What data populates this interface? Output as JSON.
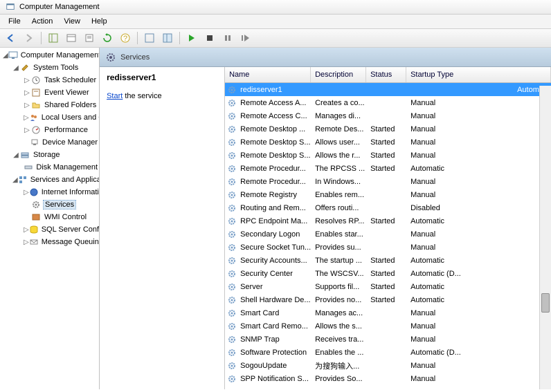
{
  "title": "Computer Management",
  "menu": [
    "File",
    "Action",
    "View",
    "Help"
  ],
  "tree": {
    "root": "Computer Management (Local",
    "systools": "System Tools",
    "systools_items": [
      "Task Scheduler",
      "Event Viewer",
      "Shared Folders",
      "Local Users and Groups",
      "Performance",
      "Device Manager"
    ],
    "storage": "Storage",
    "storage_items": [
      "Disk Management"
    ],
    "sapps": "Services and Applications",
    "sapps_items": [
      "Internet Information Se",
      "Services",
      "WMI Control",
      "SQL Server Configuratio",
      "Message Queuing"
    ]
  },
  "header_label": "Services",
  "detail": {
    "title": "redisserver1",
    "link": "Start",
    "link_rest": " the service"
  },
  "columns": {
    "name": "Name",
    "desc": "Description",
    "status": "Status",
    "startup": "Startup Type"
  },
  "services": [
    {
      "name": "redisserver1",
      "desc": "",
      "status": "",
      "startup": "Automatic",
      "selected": true
    },
    {
      "name": "Remote Access A...",
      "desc": "Creates a co...",
      "status": "",
      "startup": "Manual"
    },
    {
      "name": "Remote Access C...",
      "desc": "Manages di...",
      "status": "",
      "startup": "Manual"
    },
    {
      "name": "Remote Desktop ...",
      "desc": "Remote Des...",
      "status": "Started",
      "startup": "Manual"
    },
    {
      "name": "Remote Desktop S...",
      "desc": "Allows user...",
      "status": "Started",
      "startup": "Manual"
    },
    {
      "name": "Remote Desktop S...",
      "desc": "Allows the r...",
      "status": "Started",
      "startup": "Manual"
    },
    {
      "name": "Remote Procedur...",
      "desc": "The RPCSS ...",
      "status": "Started",
      "startup": "Automatic"
    },
    {
      "name": "Remote Procedur...",
      "desc": "In Windows...",
      "status": "",
      "startup": "Manual"
    },
    {
      "name": "Remote Registry",
      "desc": "Enables rem...",
      "status": "",
      "startup": "Manual"
    },
    {
      "name": "Routing and Rem...",
      "desc": "Offers routi...",
      "status": "",
      "startup": "Disabled"
    },
    {
      "name": "RPC Endpoint Ma...",
      "desc": "Resolves RP...",
      "status": "Started",
      "startup": "Automatic"
    },
    {
      "name": "Secondary Logon",
      "desc": "Enables star...",
      "status": "",
      "startup": "Manual"
    },
    {
      "name": "Secure Socket Tun...",
      "desc": "Provides su...",
      "status": "",
      "startup": "Manual"
    },
    {
      "name": "Security Accounts...",
      "desc": "The startup ...",
      "status": "Started",
      "startup": "Automatic"
    },
    {
      "name": "Security Center",
      "desc": "The WSCSV...",
      "status": "Started",
      "startup": "Automatic (D..."
    },
    {
      "name": "Server",
      "desc": "Supports fil...",
      "status": "Started",
      "startup": "Automatic"
    },
    {
      "name": "Shell Hardware De...",
      "desc": "Provides no...",
      "status": "Started",
      "startup": "Automatic"
    },
    {
      "name": "Smart Card",
      "desc": "Manages ac...",
      "status": "",
      "startup": "Manual"
    },
    {
      "name": "Smart Card Remo...",
      "desc": "Allows the s...",
      "status": "",
      "startup": "Manual"
    },
    {
      "name": "SNMP Trap",
      "desc": "Receives tra...",
      "status": "",
      "startup": "Manual"
    },
    {
      "name": "Software Protection",
      "desc": "Enables the ...",
      "status": "",
      "startup": "Automatic (D..."
    },
    {
      "name": "SogouUpdate",
      "desc": "为搜狗输入...",
      "status": "",
      "startup": "Manual"
    },
    {
      "name": "SPP Notification S...",
      "desc": "Provides So...",
      "status": "",
      "startup": "Manual"
    }
  ]
}
